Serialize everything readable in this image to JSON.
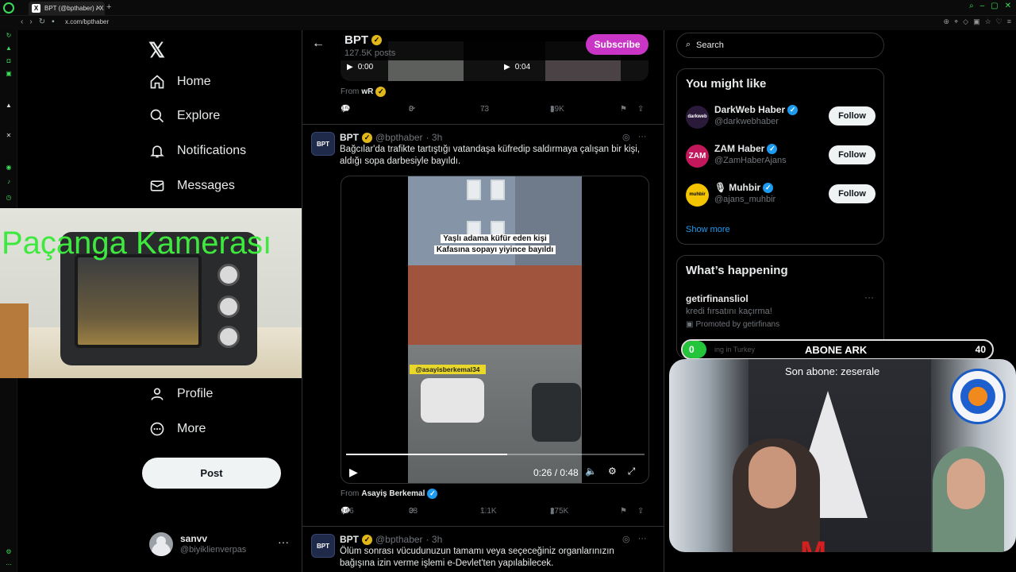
{
  "browser": {
    "tab_title": "BPT (@bpthaber) / X",
    "tab_favicon": "X",
    "url": "x.com/bpthaber"
  },
  "nav": {
    "items": [
      {
        "label": "Home",
        "icon": "home-icon"
      },
      {
        "label": "Explore",
        "icon": "search-icon"
      },
      {
        "label": "Notifications",
        "icon": "bell-icon"
      },
      {
        "label": "Messages",
        "icon": "mail-icon"
      },
      {
        "label": "Profile",
        "icon": "person-icon"
      },
      {
        "label": "More",
        "icon": "more-circle-icon"
      }
    ],
    "post_label": "Post",
    "account": {
      "name": "sanvv",
      "handle": "@biyiklienverpas"
    }
  },
  "webcam_overlay": {
    "title": "Paçanga Kamerası"
  },
  "profile_header": {
    "name": "BPT",
    "post_count": "127.5K posts",
    "subscribe_label": "Subscribe"
  },
  "prev_tweet": {
    "video1_time": "0:00",
    "video2_time": "0:04",
    "from_label": "From",
    "from_name": "wR",
    "stats": {
      "replies": "15",
      "reposts": "8",
      "likes": "73",
      "views": "39K"
    }
  },
  "tweet1": {
    "name": "BPT",
    "handle": "@bpthaber",
    "time": "· 3h",
    "text": "Bağcılar'da trafikte tartıştığı vatandaşa küfredip saldırmaya çalışan bir kişi, aldığı sopa darbesiyle bayıldı.",
    "video": {
      "caption_line1": "Yaşlı adama küfür eden kişi",
      "caption_line2": "Kafasına sopayı yiyince bayıldı",
      "tag": "@asayisberkemal34",
      "time": "0:26 / 0:48",
      "progress": 0.54
    },
    "from_label": "From",
    "from_name": "Asayiş Berkemal",
    "stats": {
      "replies": "146",
      "reposts": "33",
      "likes": "1.1K",
      "views": "275K"
    }
  },
  "tweet2": {
    "name": "BPT",
    "handle": "@bpthaber",
    "time": "· 3h",
    "text": "Ölüm sonrası vücudunuzun tamamı veya seçeceğiniz organlarınızın bağışına izin verme işlemi e-Devlet'ten yapılabilecek."
  },
  "avatar_text": "BPT",
  "search": {
    "placeholder": "Search"
  },
  "you_might_like": {
    "title": "You might like",
    "items": [
      {
        "name": "DarkWeb Haber",
        "handle": "@darkwebhaber",
        "avatar_text": "darkweb",
        "avatar_color": "#2a1a3a"
      },
      {
        "name": "ZAM Haber",
        "handle": "@ZamHaberAjans",
        "avatar_text": "ZAM",
        "avatar_color": "#c2185b"
      },
      {
        "name": "Muhbir",
        "handle": "@ajans_muhbir",
        "avatar_text": "muhbir",
        "avatar_color": "#f4c400"
      }
    ],
    "follow_label": "Follow",
    "show_more": "Show more"
  },
  "whats_happening": {
    "title": "What’s happening",
    "promo_name": "getirfinansliol",
    "promo_text": "kredi fırsatını kaçırma!",
    "promo_by": "Promoted by getirfinans",
    "trending_ghost": "ing in Turkey"
  },
  "sub_goal": {
    "current": "0",
    "label": "ABONE ARK",
    "goal": "40"
  },
  "streamer_cam": {
    "last_sub": "Son abone: zeserale",
    "logo": "M"
  },
  "colors": {
    "accent": "#1d9bf0",
    "subscribe": "#c936c6",
    "goal_fill": "#24c53a",
    "overlay_text": "#3ee83e"
  }
}
